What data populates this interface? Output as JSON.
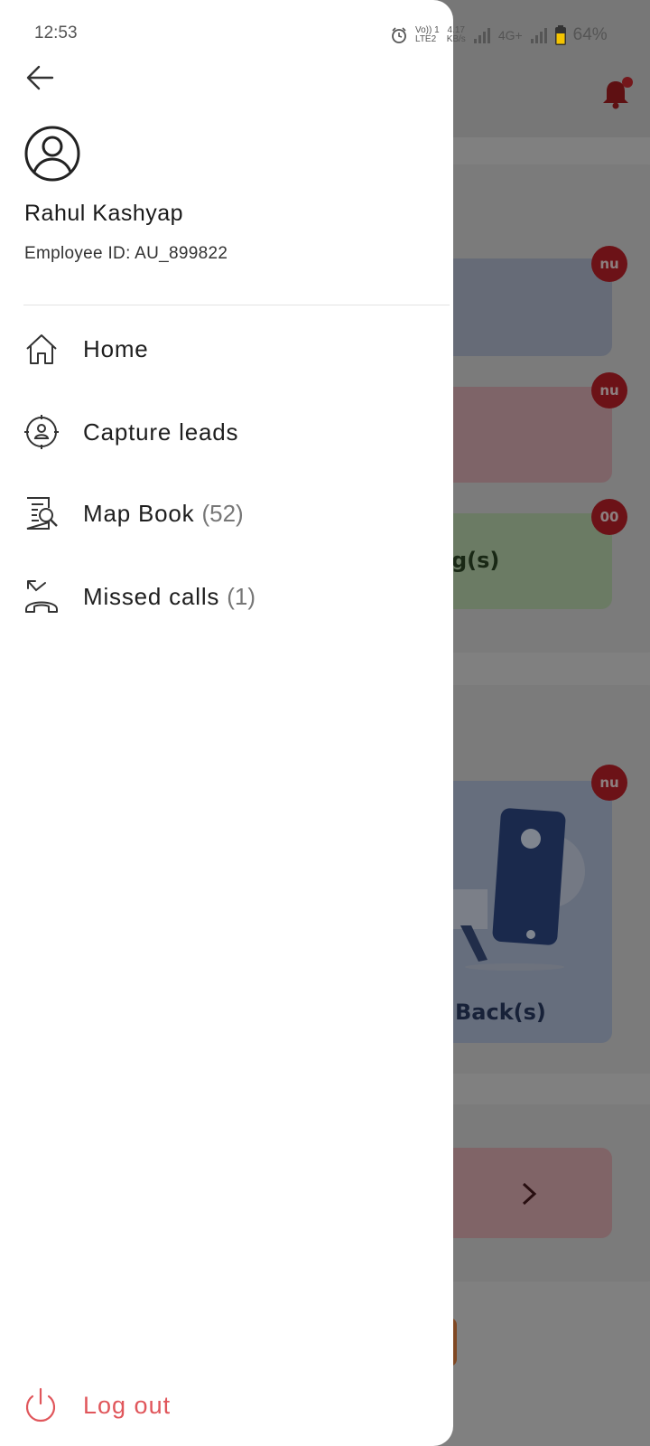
{
  "status_bar": {
    "time": "12:53",
    "network_type_top": "Vo)) 1",
    "network_type_bottom": "LTE2",
    "speed_value": "4.17",
    "speed_unit": "KB/s",
    "network_label": "4G+",
    "battery": "64%"
  },
  "drawer": {
    "user_name": "Rahul Kashyap",
    "employee_id": "Employee ID: AU_899822",
    "menu": [
      {
        "label": "Home",
        "count": "",
        "icon": "home-icon"
      },
      {
        "label": "Capture leads",
        "count": "",
        "icon": "capture-leads-icon"
      },
      {
        "label": "Map Book",
        "count": "(52)",
        "icon": "map-book-icon"
      },
      {
        "label": "Missed calls",
        "count": "(1)",
        "icon": "missed-calls-icon"
      }
    ],
    "logout_label": "Log out"
  },
  "background_app": {
    "badges": [
      "nu",
      "nu",
      "00",
      "nu"
    ],
    "tile_meeting_text": "g(s)",
    "tile_callback_text": "Back(s)"
  },
  "colors": {
    "logout": "#e0565b",
    "badge": "#b5121b",
    "drawer_bg": "#ffffff"
  }
}
